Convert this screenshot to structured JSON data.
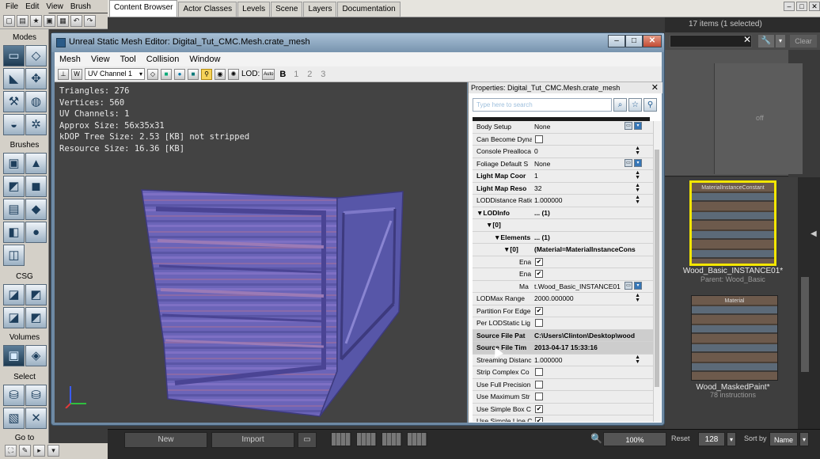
{
  "main_menu": [
    "File",
    "Edit",
    "View",
    "Brush"
  ],
  "toolbox": {
    "sections": [
      "Modes",
      "Brushes",
      "CSG",
      "Volumes",
      "Select",
      "Go to"
    ]
  },
  "content_browser": {
    "tabs": [
      "Content Browser",
      "Actor Classes",
      "Levels",
      "Scene",
      "Layers",
      "Documentation"
    ],
    "active_tab": 0,
    "item_count": "17 items (1 selected)",
    "clear_label": "Clear",
    "panel_text": "off",
    "assets": [
      {
        "caption": "MaterialInstanceConstant",
        "name": "Wood_Basic_INSTANCE01*",
        "sub": "Parent: Wood_Basic",
        "selected": true
      },
      {
        "caption": "Material",
        "name": "Wood_MaskedPaint*",
        "sub": "78 instructions",
        "selected": false
      }
    ],
    "bottom": {
      "new_label": "New",
      "import_label": "Import",
      "zoom": "100%",
      "reset_label": "Reset",
      "thumb_size": "128",
      "sort_label": "Sort by",
      "sort_value": "Name"
    }
  },
  "sme": {
    "title": "Unreal Static Mesh Editor: Digital_Tut_CMC.Mesh.crate_mesh",
    "menu": [
      "Mesh",
      "View",
      "Tool",
      "Collision",
      "Window"
    ],
    "uv_channel": "UV Channel 1",
    "lod_label": "LOD:",
    "lod_auto": "Auto",
    "lod_levels": [
      "B",
      "1",
      "2",
      "3"
    ],
    "stats": [
      "Triangles: 276",
      "Vertices: 560",
      "UV Channels: 1",
      "Approx Size: 56x35x31",
      "kDOP Tree Size: 2.53 [KB] not stripped",
      "Resource Size: 16.36 [KB]"
    ],
    "properties": {
      "title": "Properties: Digital_Tut_CMC.Mesh.crate_mesh",
      "search_placeholder": "Type here to search",
      "rows": [
        {
          "name": "Body Setup",
          "value": "None",
          "kind": "text",
          "buttons": true
        },
        {
          "name": "Can Become Dyna",
          "kind": "check",
          "checked": false
        },
        {
          "name": "Console Prealloca",
          "value": "0",
          "kind": "text",
          "spin": true
        },
        {
          "name": "Foliage Default S",
          "value": "None",
          "kind": "text",
          "buttons": true
        },
        {
          "name": "Light Map Coor",
          "value": "1",
          "kind": "text",
          "bold": true,
          "spin": true
        },
        {
          "name": "Light Map Reso",
          "value": "32",
          "kind": "text",
          "bold": true,
          "spin": true
        },
        {
          "name": "LODDistance Ratio",
          "value": "1.000000",
          "kind": "text",
          "spin": true
        },
        {
          "name": "▼LODInfo",
          "value": "... (1)",
          "kind": "text",
          "bold": true,
          "vbold": true,
          "indent": 0
        },
        {
          "name": "▼[0]",
          "value": "",
          "kind": "text",
          "bold": true,
          "indent": 12
        },
        {
          "name": "▼Elements",
          "value": "... (1)",
          "kind": "text",
          "bold": true,
          "vbold": true,
          "indent": 22
        },
        {
          "name": "▼[0]",
          "value": "(Material=MaterialInstanceCons",
          "kind": "text",
          "bold": true,
          "vbold": true,
          "indent": 34
        },
        {
          "name": "Ena",
          "kind": "check",
          "checked": true,
          "indent": 54
        },
        {
          "name": "Ena",
          "kind": "check",
          "checked": true,
          "indent": 54
        },
        {
          "name": "Ma",
          "value": "t.Wood_Basic_INSTANCE01",
          "kind": "text",
          "indent": 54,
          "buttons": true
        },
        {
          "name": "LODMax Range",
          "value": "2000.000000",
          "kind": "text",
          "spin": true
        },
        {
          "name": "Partition For Edge",
          "kind": "check",
          "checked": true
        },
        {
          "name": "Per LODStatic Lig",
          "kind": "check",
          "checked": false
        },
        {
          "name": "Source File Pat",
          "value": "C:\\Users\\Clinton\\Desktop\\wood",
          "kind": "text",
          "bold": true,
          "vbold": true,
          "hl": true
        },
        {
          "name": "Source File Tim",
          "value": "2013-04-17 15:33:16",
          "kind": "text",
          "bold": true,
          "vbold": true,
          "hl": true
        },
        {
          "name": "Streaming Distanc",
          "value": "1.000000",
          "kind": "text",
          "spin": true
        },
        {
          "name": "Strip Complex Co",
          "kind": "check",
          "checked": false
        },
        {
          "name": "Use Full Precision",
          "kind": "check",
          "checked": false
        },
        {
          "name": "Use Maximum Str",
          "kind": "check",
          "checked": false
        },
        {
          "name": "Use Simple Box C",
          "kind": "check",
          "checked": true
        },
        {
          "name": "Use Simple Line C",
          "kind": "check",
          "checked": true
        }
      ]
    }
  }
}
